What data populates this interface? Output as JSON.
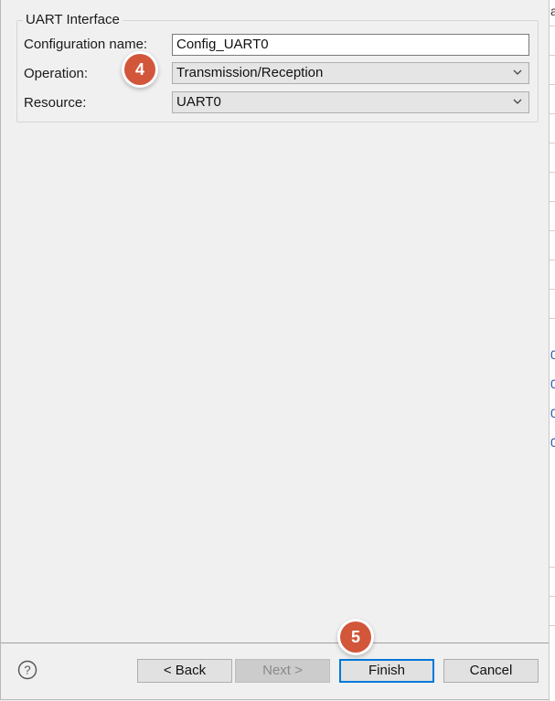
{
  "group": {
    "title": "UART Interface"
  },
  "fields": {
    "config_name_label": "Configuration name:",
    "config_name_value": "Config_UART0",
    "operation_label": "Operation:",
    "operation_value": "Transmission/Reception",
    "resource_label": "Resource:",
    "resource_value": "UART0"
  },
  "badges": {
    "step4": "4",
    "step5": "5"
  },
  "buttons": {
    "back": "< Back",
    "next": "Next >",
    "finish": "Finish",
    "cancel": "Cancel"
  },
  "background_fragments": {
    "a": "a",
    "o1": "0",
    "o2": "0",
    "o3": "0",
    "o4": "0"
  },
  "colors": {
    "badge": "#d2563a",
    "default_button_border": "#0078d7"
  }
}
